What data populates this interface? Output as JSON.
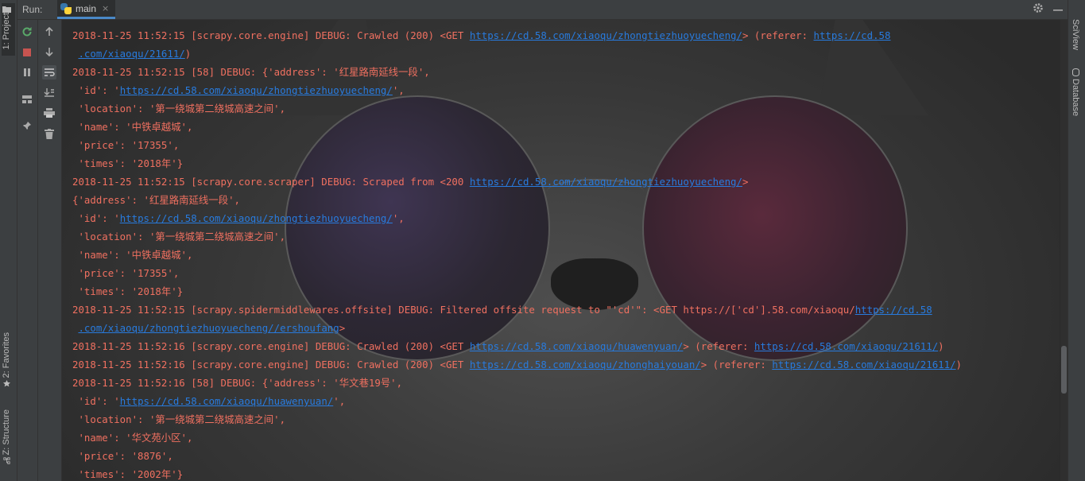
{
  "left_stripe": {
    "project_tab": "1: Project",
    "favorites_tab": "2: Favorites",
    "structure_tab": "Z: Structure"
  },
  "right_stripe": {
    "sciview_tab": "SciView",
    "database_tab": "Database"
  },
  "header": {
    "run_label": "Run:",
    "tab_label": "main",
    "tab_icon": "python-icon",
    "tab_close": "×",
    "settings_icon": "gear-icon",
    "minimize_icon": "minimize-icon"
  },
  "actions": {
    "col1": [
      "rerun-icon",
      "stop-icon",
      "pause-icon",
      "layout-icon",
      "pin-icon"
    ],
    "col2": [
      "arrow-up-icon",
      "arrow-down-icon",
      "soft-wrap-icon",
      "scroll-to-end-icon",
      "print-icon",
      "trash-icon"
    ]
  },
  "colors": {
    "log_text": "#f07060",
    "link": "#287bde",
    "background": "#2b2b2b",
    "panel": "#3c3f41"
  },
  "console": {
    "lines": [
      [
        {
          "t": "2018-11-25 11:52:15 [scrapy.core.engine] DEBUG: Crawled (200) <GET "
        },
        {
          "t": "https://cd.58.com/xiaoqu/zhongtiezhuoyuecheng/",
          "link": true
        },
        {
          "t": "> (referer: "
        },
        {
          "t": "https://cd.58",
          "link": true
        }
      ],
      [
        {
          "t": " "
        },
        {
          "t": ".com/xiaoqu/21611/",
          "link": true
        },
        {
          "t": ")"
        }
      ],
      [
        {
          "t": "2018-11-25 11:52:15 [58] DEBUG: {'address': '红星路南延线一段',"
        }
      ],
      [
        {
          "t": " 'id': '"
        },
        {
          "t": "https://cd.58.com/xiaoqu/zhongtiezhuoyuecheng/",
          "link": true
        },
        {
          "t": "',"
        }
      ],
      [
        {
          "t": " 'location': '第一绕城第二绕城高速之间',"
        }
      ],
      [
        {
          "t": " 'name': '中铁卓越城',"
        }
      ],
      [
        {
          "t": " 'price': '17355',"
        }
      ],
      [
        {
          "t": " 'times': '2018年'}"
        }
      ],
      [
        {
          "t": "2018-11-25 11:52:15 [scrapy.core.scraper] DEBUG: Scraped from <200 "
        },
        {
          "t": "https://cd.58.com/xiaoqu/zhongtiezhuoyuecheng/",
          "link": true
        },
        {
          "t": ">"
        }
      ],
      [
        {
          "t": "{'address': '红星路南延线一段',"
        }
      ],
      [
        {
          "t": " 'id': '"
        },
        {
          "t": "https://cd.58.com/xiaoqu/zhongtiezhuoyuecheng/",
          "link": true
        },
        {
          "t": "',"
        }
      ],
      [
        {
          "t": " 'location': '第一绕城第二绕城高速之间',"
        }
      ],
      [
        {
          "t": " 'name': '中铁卓越城',"
        }
      ],
      [
        {
          "t": " 'price': '17355',"
        }
      ],
      [
        {
          "t": " 'times': '2018年'}"
        }
      ],
      [
        {
          "t": "2018-11-25 11:52:15 [scrapy.spidermiddlewares.offsite] DEBUG: Filtered offsite request to \"'cd'\": <GET https://['cd'].58.com/xiaoqu/"
        },
        {
          "t": "https://cd.58",
          "link": true
        }
      ],
      [
        {
          "t": " "
        },
        {
          "t": ".com/xiaoqu/zhongtiezhuoyuecheng//ershoufang",
          "link": true
        },
        {
          "t": ">"
        }
      ],
      [
        {
          "t": "2018-11-25 11:52:16 [scrapy.core.engine] DEBUG: Crawled (200) <GET "
        },
        {
          "t": "https://cd.58.com/xiaoqu/huawenyuan/",
          "link": true
        },
        {
          "t": "> (referer: "
        },
        {
          "t": "https://cd.58.com/xiaoqu/21611/",
          "link": true
        },
        {
          "t": ")"
        }
      ],
      [
        {
          "t": "2018-11-25 11:52:16 [scrapy.core.engine] DEBUG: Crawled (200) <GET "
        },
        {
          "t": "https://cd.58.com/xiaoqu/zhonghaiyouan/",
          "link": true
        },
        {
          "t": "> (referer: "
        },
        {
          "t": "https://cd.58.com/xiaoqu/21611/",
          "link": true
        },
        {
          "t": ")"
        }
      ],
      [
        {
          "t": "2018-11-25 11:52:16 [58] DEBUG: {'address': '华文巷19号',"
        }
      ],
      [
        {
          "t": " 'id': '"
        },
        {
          "t": "https://cd.58.com/xiaoqu/huawenyuan/",
          "link": true
        },
        {
          "t": "',"
        }
      ],
      [
        {
          "t": " 'location': '第一绕城第二绕城高速之间',"
        }
      ],
      [
        {
          "t": " 'name': '华文苑小区',"
        }
      ],
      [
        {
          "t": " 'price': '8876',"
        }
      ],
      [
        {
          "t": " 'times': '2002年'}"
        }
      ]
    ]
  }
}
